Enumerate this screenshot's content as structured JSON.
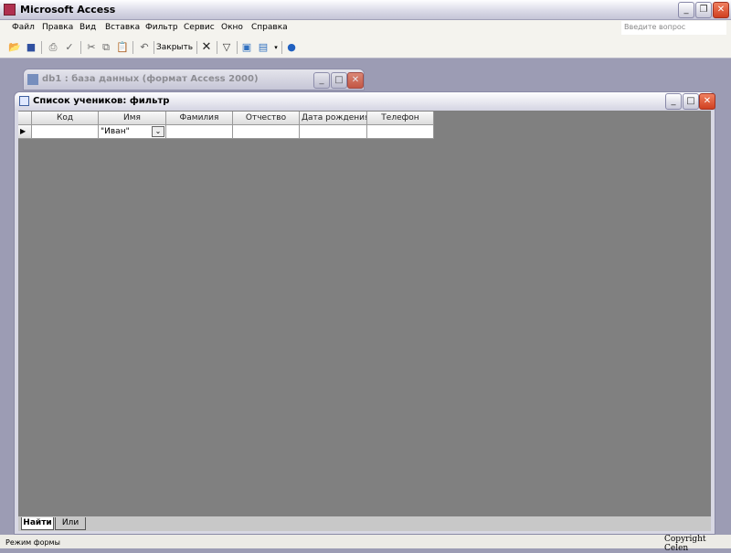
{
  "app": {
    "title": "Microsoft Access"
  },
  "menu": [
    "Файл",
    "Правка",
    "Вид",
    "Вставка",
    "Фильтр",
    "Сервис",
    "Окно",
    "Справка"
  ],
  "ask_placeholder": "Введите вопрос",
  "toolbar": {
    "close_label": "Закрыть"
  },
  "db_window": {
    "title": "db1 : база данных (формат Access 2000)"
  },
  "form_window": {
    "title": "Список учеников: фильтр"
  },
  "columns": [
    "Код",
    "Имя",
    "Фамилия",
    "Отчество",
    "Дата рождения",
    "Телефон"
  ],
  "row": {
    "name_value": "\"Иван\""
  },
  "tabs": [
    "Найти",
    "Или"
  ],
  "status": {
    "mode": "Режим формы",
    "copyright": "Copyright Celen"
  }
}
